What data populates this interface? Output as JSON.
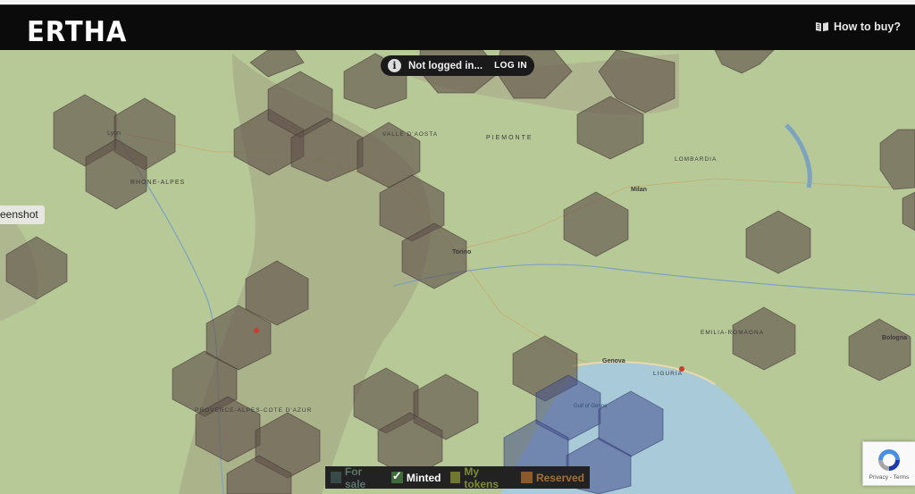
{
  "header": {
    "logo": "ERTHA",
    "how_to_buy": "How to buy?"
  },
  "notice": {
    "info_glyph": "i",
    "status": "Not logged in...",
    "login_label": "LOG IN"
  },
  "left_tab": {
    "label": "eenshot"
  },
  "map": {
    "labels": [
      "Lyon",
      "RHONE-ALPES",
      "VALLE D'AOSTA",
      "PIEMONTE",
      "LOMBARDIA",
      "Milan",
      "Torino",
      "EMILIA-ROMAGNA",
      "Bologna",
      "Genova",
      "LIGURIA",
      "PROVENCE-ALPES-COTE D'AZUR",
      "Gulf of Genoa"
    ]
  },
  "legend": {
    "items": [
      {
        "label": "For sale",
        "color": "#3a4a48",
        "checked": false
      },
      {
        "label": "Minted",
        "color": "#3f6b3a",
        "checked": true
      },
      {
        "label": "My tokens",
        "color": "#6f7730",
        "checked": false
      },
      {
        "label": "Reserved",
        "color": "#8a5a2a",
        "checked": false
      }
    ],
    "text_colors": [
      "#5c7470",
      "#ffffff",
      "#7f8a3c",
      "#a0703a"
    ]
  },
  "recaptcha": {
    "text": "Privacy - Terms"
  }
}
